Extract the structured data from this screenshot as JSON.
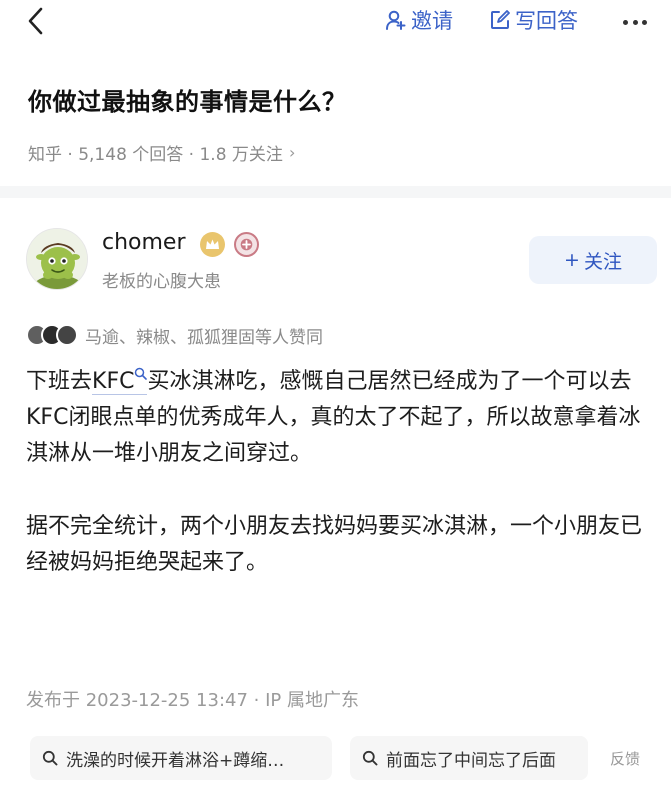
{
  "topbar": {
    "back_icon": "chevron-left-icon",
    "invite_label": "邀请",
    "invite_icon": "person-add-icon",
    "write_label": "写回答",
    "write_icon": "edit-icon",
    "more_icon": "more-dots-icon"
  },
  "question": {
    "title": "你做过最抽象的事情是什么？",
    "meta": "知乎 · 5,148 个回答 · 1.8 万关注",
    "meta_chevron": "›"
  },
  "author": {
    "name": "chomer",
    "headline": "老板的心腹大患",
    "follow_label": "关注",
    "follow_plus": "+",
    "badges": [
      "crown-badge-icon",
      "plus-badge-icon"
    ]
  },
  "likers": {
    "text": "马逾、辣椒、孤狐狸固等人赞同"
  },
  "answer": {
    "p1_before": "下班去",
    "p1_link": "KFC",
    "p1_after": "买冰淇淋吃，感慨自己居然已经成为了一个可以去KFC闭眼点单的优秀成年人，真的太了不起了，所以故意拿着冰淇淋从一堆小朋友之间穿过。",
    "p2": "据不完全统计，两个小朋友去找妈妈要买冰淇淋，一个小朋友已经被妈妈拒绝哭起来了。"
  },
  "publish": {
    "text": "发布于 2023-12-25 13:47 · IP 属地广东"
  },
  "related": [
    {
      "text": "洗澡的时候开着淋浴+蹲缩…",
      "icon": "search-icon"
    },
    {
      "text": "前面忘了中间忘了后面",
      "icon": "search-icon"
    }
  ],
  "feedback_label": "反馈",
  "colors": {
    "accent": "#3c63c8",
    "muted": "#8a8a8a",
    "follow_bg": "#eef3fb"
  }
}
